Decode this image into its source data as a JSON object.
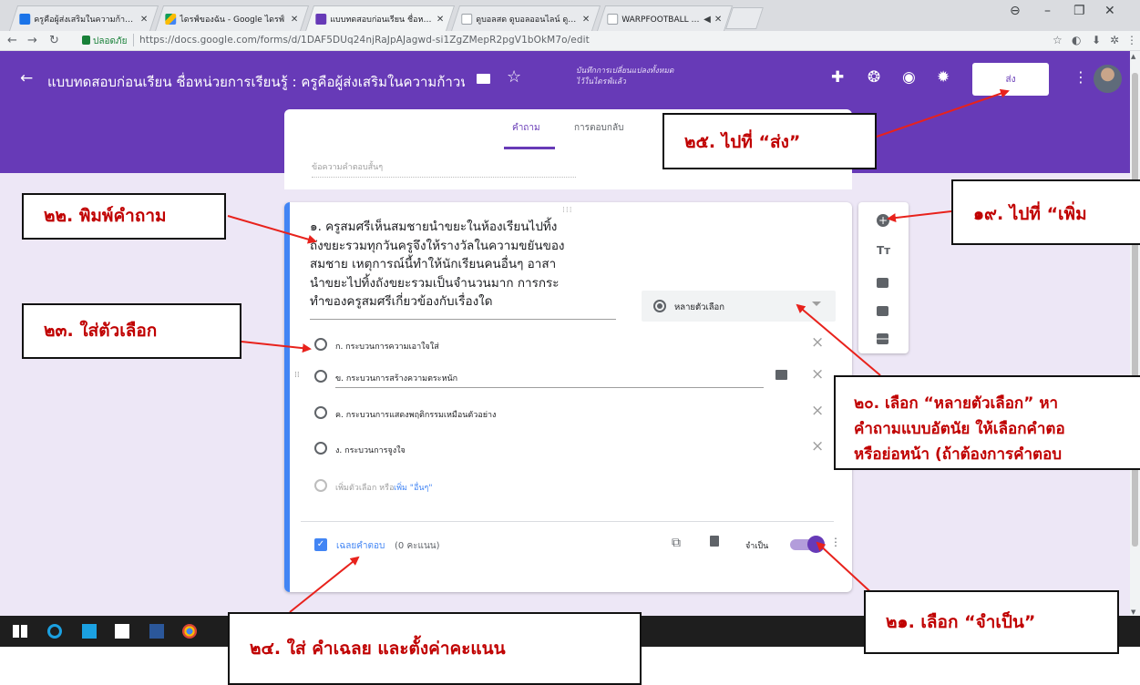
{
  "browser": {
    "tabs": [
      {
        "label": "ครูคือผู้ส่งเสริมในความก้าวหน้",
        "icon_color": "#1a73e8"
      },
      {
        "label": "ไดรฟ์ของฉัน - Google ไดรฟ์",
        "icon_color": "#fbbc04"
      },
      {
        "label": "แบบทดสอบก่อนเรียน ชื่อหน่วย",
        "icon_color": "#673ab7"
      },
      {
        "label": "ดูบอลสด ดูบอลออนไลน์ ดูบอล",
        "icon_color": "#ffffff"
      },
      {
        "label": "WARPFOOTBALL - ดู",
        "icon_color": "#ffffff"
      }
    ],
    "secure_label": "ปลอดภัย",
    "url": "https://docs.google.com/forms/d/1DAF5DUq24njRaJpAJagwd-si1ZgZMepR2pgV1bOkM7o/edit"
  },
  "form_header": {
    "title": "แบบทดสอบก่อนเรียน ชื่อหน่วยการเรียนรู้ : ครูคือผู้ส่งเสริมในความก้าวหน้",
    "saved_status": "บันทึกการเปลี่ยนแปลงทั้งหมดไว้ในไดรฟ์แล้ว",
    "send_label": "ส่ง",
    "accent_color": "#673ab7"
  },
  "form_tabs": {
    "questions": "คำถาม",
    "responses": "การตอบกลับ"
  },
  "previous_question": {
    "placeholder": "ข้อความคำตอบสั้นๆ"
  },
  "question": {
    "lines": [
      "๑. ครูสมศรีเห็นสมชายนำขยะในห้องเรียนไปทิ้ง",
      "ถังขยะรวมทุกวันครูจึงให้รางวัลในความขยันของ",
      "สมชาย เหตุการณ์นี้ทำให้นักเรียนคนอื่นๆ อาสา",
      "นำขยะไปทิ้งถังขยะรวมเป็นจำนวนมาก การกระ",
      "ทำของครูสมศรีเกี่ยวข้องกับเรื่องใด"
    ],
    "type_label": "หลายตัวเลือก",
    "options": [
      "ก. กระบวนการความเอาใจใส่",
      "ข. กระบวนการสร้างความตระหนัก",
      "ค. กระบวนการแสดงพฤติกรรมเหมือนตัวอย่าง",
      "ง. กระบวนการจูงใจ"
    ],
    "add_option": "เพิ่มตัวเลือก",
    "or_label": "หรือ",
    "add_other": "เพิ่ม \"อื่นๆ\"",
    "answer_key": "เฉลยคำตอบ",
    "points": "(0 คะแนน)",
    "required_label": "จำเป็น"
  },
  "annotations": {
    "c19": "๑๙. ไปที่ “เพิ่ม",
    "c20_line1": "๒๐. เลือก “หลายตัวเลือก” หา",
    "c20_line2": "คำถามแบบอัตนัย ให้เลือกคำตอ",
    "c20_line3": "หรือย่อหน้า (ถ้าต้องการคำตอบ",
    "c21": "๒๑. เลือก “จำเป็น”",
    "c22": "๒๒. พิมพ์คำถาม",
    "c23": "๒๓. ใส่ตัวเลือก",
    "c24": "๒๔. ใส่ คำเฉลย และตั้งค่าคะแนน",
    "c25": "๒๕. ไปที่ “ส่ง”",
    "color": "#c00000",
    "arrow_color": "#e8221c"
  }
}
